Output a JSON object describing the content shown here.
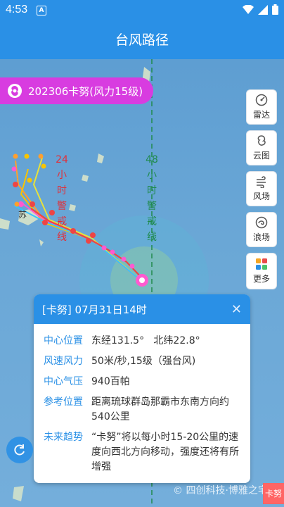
{
  "status": {
    "time": "4:53",
    "app_badge": "A"
  },
  "appbar": {
    "title": "台风路径"
  },
  "banner": {
    "label": "202306卡努(风力15级)"
  },
  "map_labels": {
    "warn24": [
      "24",
      "小",
      "时",
      "警",
      "戒",
      "线"
    ],
    "warn48": [
      "48",
      "小",
      "时",
      "警",
      "戒",
      "线"
    ],
    "place_su": "苏"
  },
  "toolbar": [
    {
      "label": "雷达",
      "icon": "radar-icon"
    },
    {
      "label": "云图",
      "icon": "cloud-map-icon"
    },
    {
      "label": "风场",
      "icon": "wind-field-icon"
    },
    {
      "label": "浪场",
      "icon": "wave-field-icon"
    },
    {
      "label": "更多",
      "icon": "more-grid-icon"
    }
  ],
  "popup": {
    "title": "[卡努] 07月31日14时",
    "rows": [
      {
        "k": "中心位置",
        "v": "东经131.5°   北纬22.8°"
      },
      {
        "k": "风速风力",
        "v": "50米/秒,15级（强台风)"
      },
      {
        "k": "中心气压",
        "v": "940百帕"
      },
      {
        "k": "参考位置",
        "v": "距离琉球群岛那霸市东南方向约540公里"
      },
      {
        "k": "未来趋势",
        "v": "“卡努”将以每小时15-20公里的速度向西北方向移动，强度还将有所增强"
      }
    ]
  },
  "watermark": "© 四创科技·博雅之宅",
  "corner_tag": "卡努",
  "colors": {
    "primary": "#2a90e6",
    "banner": "#d83ce0",
    "warn24": "#e0303a",
    "warn48": "#1f8a4c",
    "sea": "#6aa7d6"
  }
}
